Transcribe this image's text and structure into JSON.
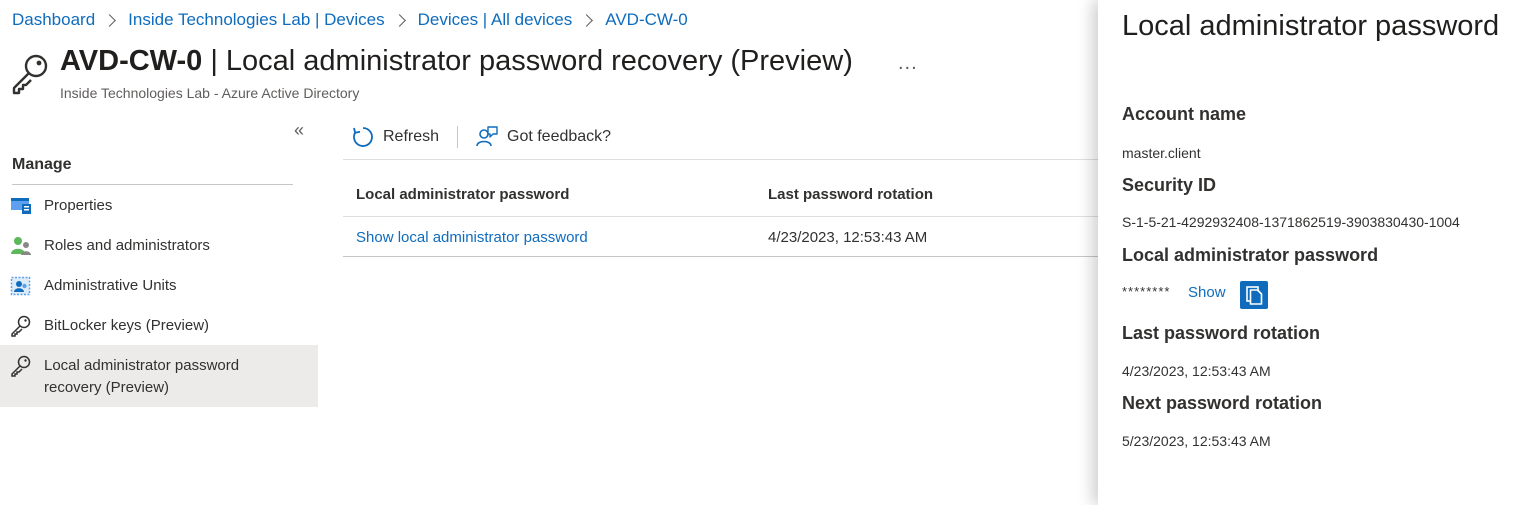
{
  "breadcrumb": [
    "Dashboard",
    "Inside Technologies Lab | Devices",
    "Devices | All devices",
    "AVD-CW-0"
  ],
  "header": {
    "title_bold": "AVD-CW-0",
    "title_rest": " | Local administrator password recovery (Preview)",
    "more": "...",
    "subtitle": "Inside Technologies Lab - Azure Active Directory",
    "icon": "key-icon"
  },
  "sidebar": {
    "collapse": "«",
    "section": "Manage",
    "items": [
      {
        "label": "Properties",
        "icon": "properties-icon"
      },
      {
        "label": "Roles and administrators",
        "icon": "roles-icon"
      },
      {
        "label": "Administrative Units",
        "icon": "admin-units-icon"
      },
      {
        "label": "BitLocker keys (Preview)",
        "icon": "key-icon"
      },
      {
        "label": "Local administrator password recovery (Preview)",
        "icon": "key-icon",
        "active": true
      }
    ]
  },
  "toolbar": {
    "refresh": "Refresh",
    "feedback": "Got feedback?"
  },
  "grid": {
    "columns": [
      "Local administrator password",
      "Last password rotation"
    ],
    "rows": [
      {
        "link": "Show local administrator password",
        "rotation": "4/23/2023, 12:53:43 AM"
      }
    ]
  },
  "panel": {
    "title": "Local administrator password",
    "account_label": "Account name",
    "account_value": "master.client",
    "sid_label": "Security ID",
    "sid_value": "S-1-5-21-4292932408-1371862519-3903830430-1004",
    "password_label": "Local administrator password",
    "password_masked": "********",
    "show_label": "Show",
    "last_label": "Last password rotation",
    "last_value": "4/23/2023, 12:53:43 AM",
    "next_label": "Next password rotation",
    "next_value": "5/23/2023, 12:53:43 AM"
  },
  "colors": {
    "accent": "#0f6cbd",
    "active_nav": "#edebe9"
  }
}
